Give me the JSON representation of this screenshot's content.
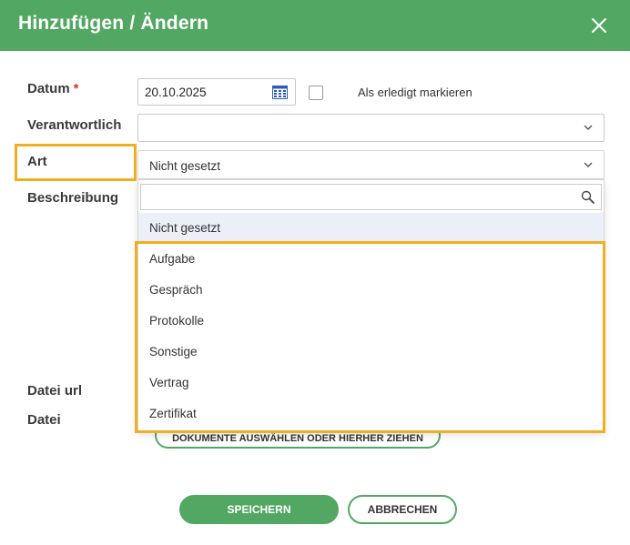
{
  "dialog": {
    "title": "Hinzufügen / Ändern",
    "close_icon": "close-icon"
  },
  "form": {
    "datum": {
      "label": "Datum",
      "required_mark": "*",
      "value": "20.10.2025",
      "icon": "calendar-icon"
    },
    "erledigt": {
      "label": "Als erledigt markieren",
      "checked": false
    },
    "verantwortlich": {
      "label": "Verantwortlich",
      "value": ""
    },
    "art": {
      "label": "Art",
      "value": "Nicht gesetzt",
      "search_placeholder": "",
      "options": [
        "Nicht gesetzt",
        "Aufgabe",
        "Gespräch",
        "Protokolle",
        "Sonstige",
        "Vertrag",
        "Zertifikat"
      ],
      "selected_index": 0
    },
    "beschreibung": {
      "label": "Beschreibung"
    },
    "datei_url": {
      "label": "Datei url"
    },
    "datei": {
      "label": "Datei",
      "upload_label": "DOKUMENTE AUSWÄHLEN ODER HIERHER ZIEHEN"
    }
  },
  "actions": {
    "save_label": "SPEICHERN",
    "cancel_label": "ABBRECHEN"
  },
  "colors": {
    "header": "#52a863",
    "accent": "#52a863",
    "highlight": "#f0ae23",
    "required": "#e03030",
    "calendar_icon": "#2f5bb5"
  }
}
